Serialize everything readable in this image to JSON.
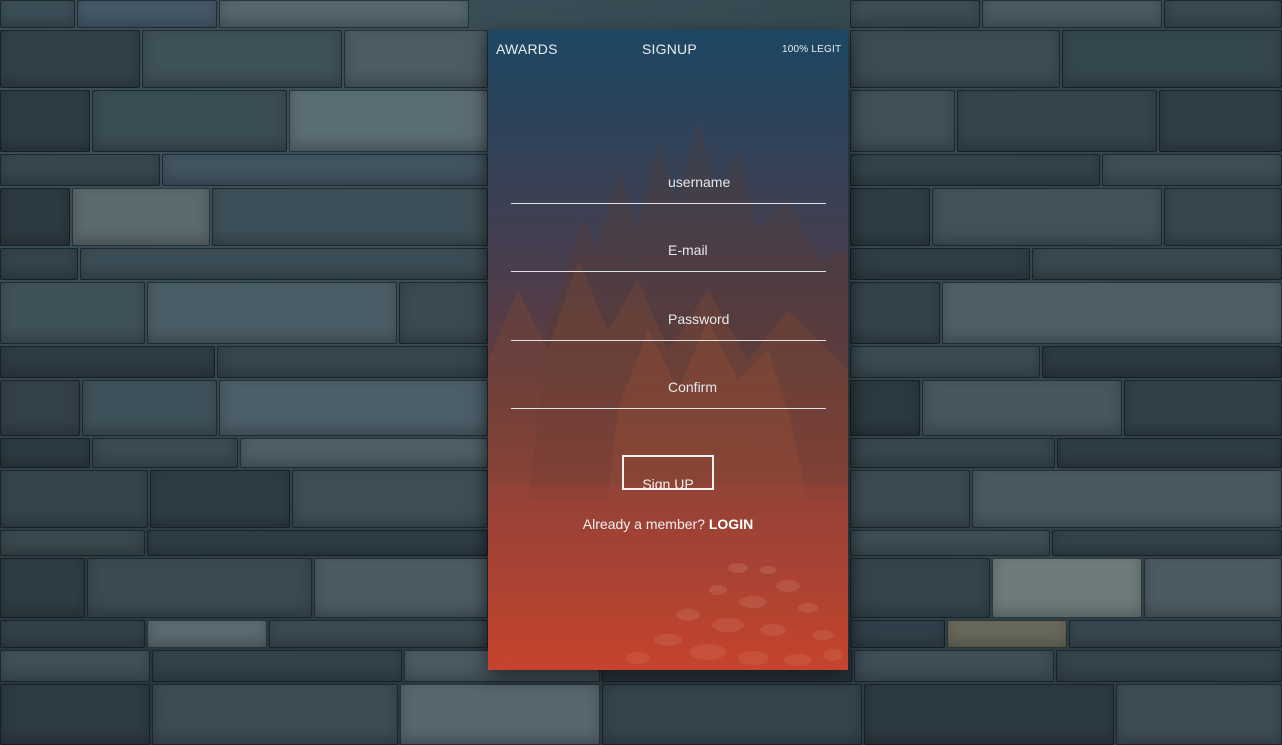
{
  "nav": {
    "awards": "AWARDS",
    "signup": "SIGNUP",
    "legit": "100% LEGIT"
  },
  "form": {
    "username_placeholder": "username",
    "email_placeholder": "E-mail",
    "password_placeholder": "Password",
    "confirm_placeholder": "Confirm",
    "submit_label": "Sign UP"
  },
  "footer": {
    "member_text": "Already a member? ",
    "login_label": "LOGIN"
  },
  "colors": {
    "card_top": "#1f4a66",
    "card_bottom": "#c7422b",
    "wall": "#2b3c44"
  }
}
